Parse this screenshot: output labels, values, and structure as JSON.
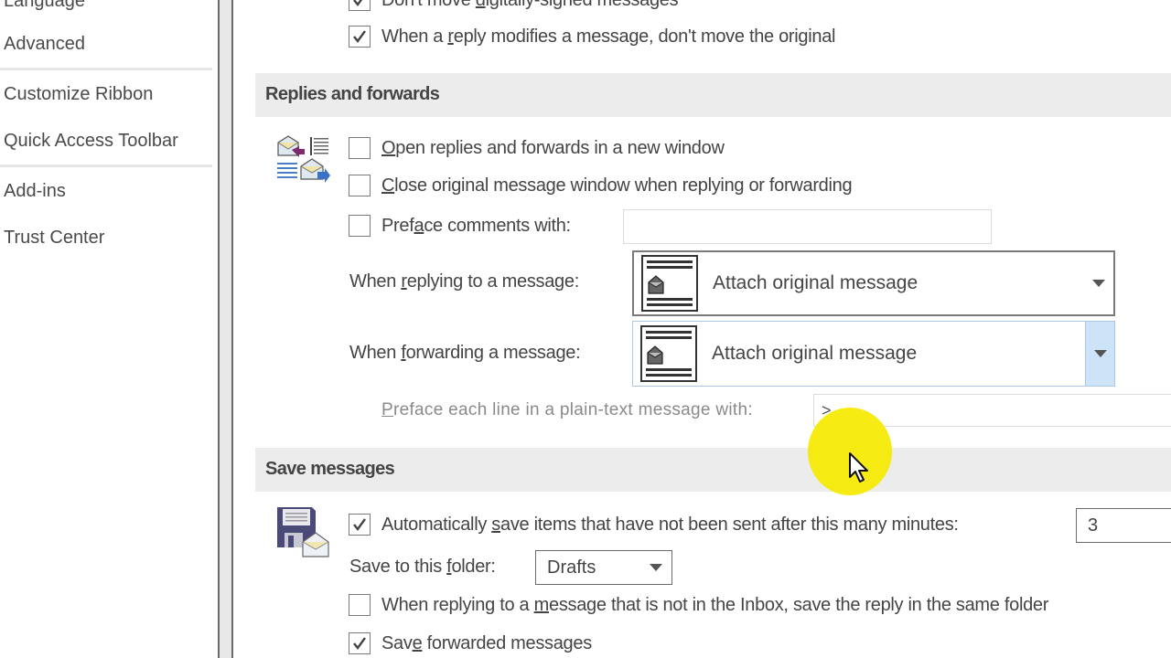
{
  "sidebar": {
    "items": [
      {
        "label": "Language"
      },
      {
        "label": "Advanced"
      },
      {
        "label": "Customize Ribbon"
      },
      {
        "label": "Quick Access Toolbar"
      },
      {
        "label": "Add-ins"
      },
      {
        "label": "Trust Center"
      }
    ]
  },
  "top_options": [
    {
      "pre": "Don't move ",
      "u": "d",
      "post": "igitally-signed messages",
      "checked": true
    },
    {
      "pre": "When a ",
      "u": "r",
      "post": "eply modifies a message, don't move the original",
      "checked": true
    }
  ],
  "replies": {
    "header": "Replies and forwards",
    "icon": "reply-forward-icon",
    "open_new_window": {
      "pre": "",
      "u": "O",
      "post": "pen replies and forwards in a new window",
      "checked": false
    },
    "close_original": {
      "pre": "",
      "u": "C",
      "post": "lose original message window when replying or forwarding",
      "checked": false
    },
    "preface_comments": {
      "pre": "Pref",
      "u": "a",
      "post": "ce comments with:",
      "checked": false,
      "value": ""
    },
    "when_replying": {
      "pre": "When ",
      "u": "r",
      "post": "eplying to a message:",
      "value": "Attach original message"
    },
    "when_forwarding": {
      "pre": "When ",
      "u": "f",
      "post": "orwarding a message:",
      "value": "Attach original message"
    },
    "preface_line": {
      "pre": "",
      "u": "P",
      "post": "reface each line in a plain-text message with:",
      "value": ">"
    }
  },
  "save": {
    "header": "Save messages",
    "icon": "floppy-envelope-icon",
    "auto_save": {
      "pre": "Automatically ",
      "u": "s",
      "post": "ave items that have not been sent after this many minutes:",
      "checked": true,
      "minutes": "3"
    },
    "save_folder": {
      "pre": "Save to this ",
      "u": "f",
      "post": "older:",
      "value": "Drafts"
    },
    "reply_same_folder": {
      "pre": "When replying to a ",
      "u": "m",
      "post": "essage that is not in the Inbox, save the reply in the same folder",
      "checked": false
    },
    "save_forwarded": {
      "pre": "Sav",
      "u": "e",
      "post": " forwarded messages",
      "checked": true
    }
  },
  "colors": {
    "section_bg": "#ececec",
    "focus_blue": "#cde3f7",
    "cursor_highlight": "#f5ea00"
  }
}
